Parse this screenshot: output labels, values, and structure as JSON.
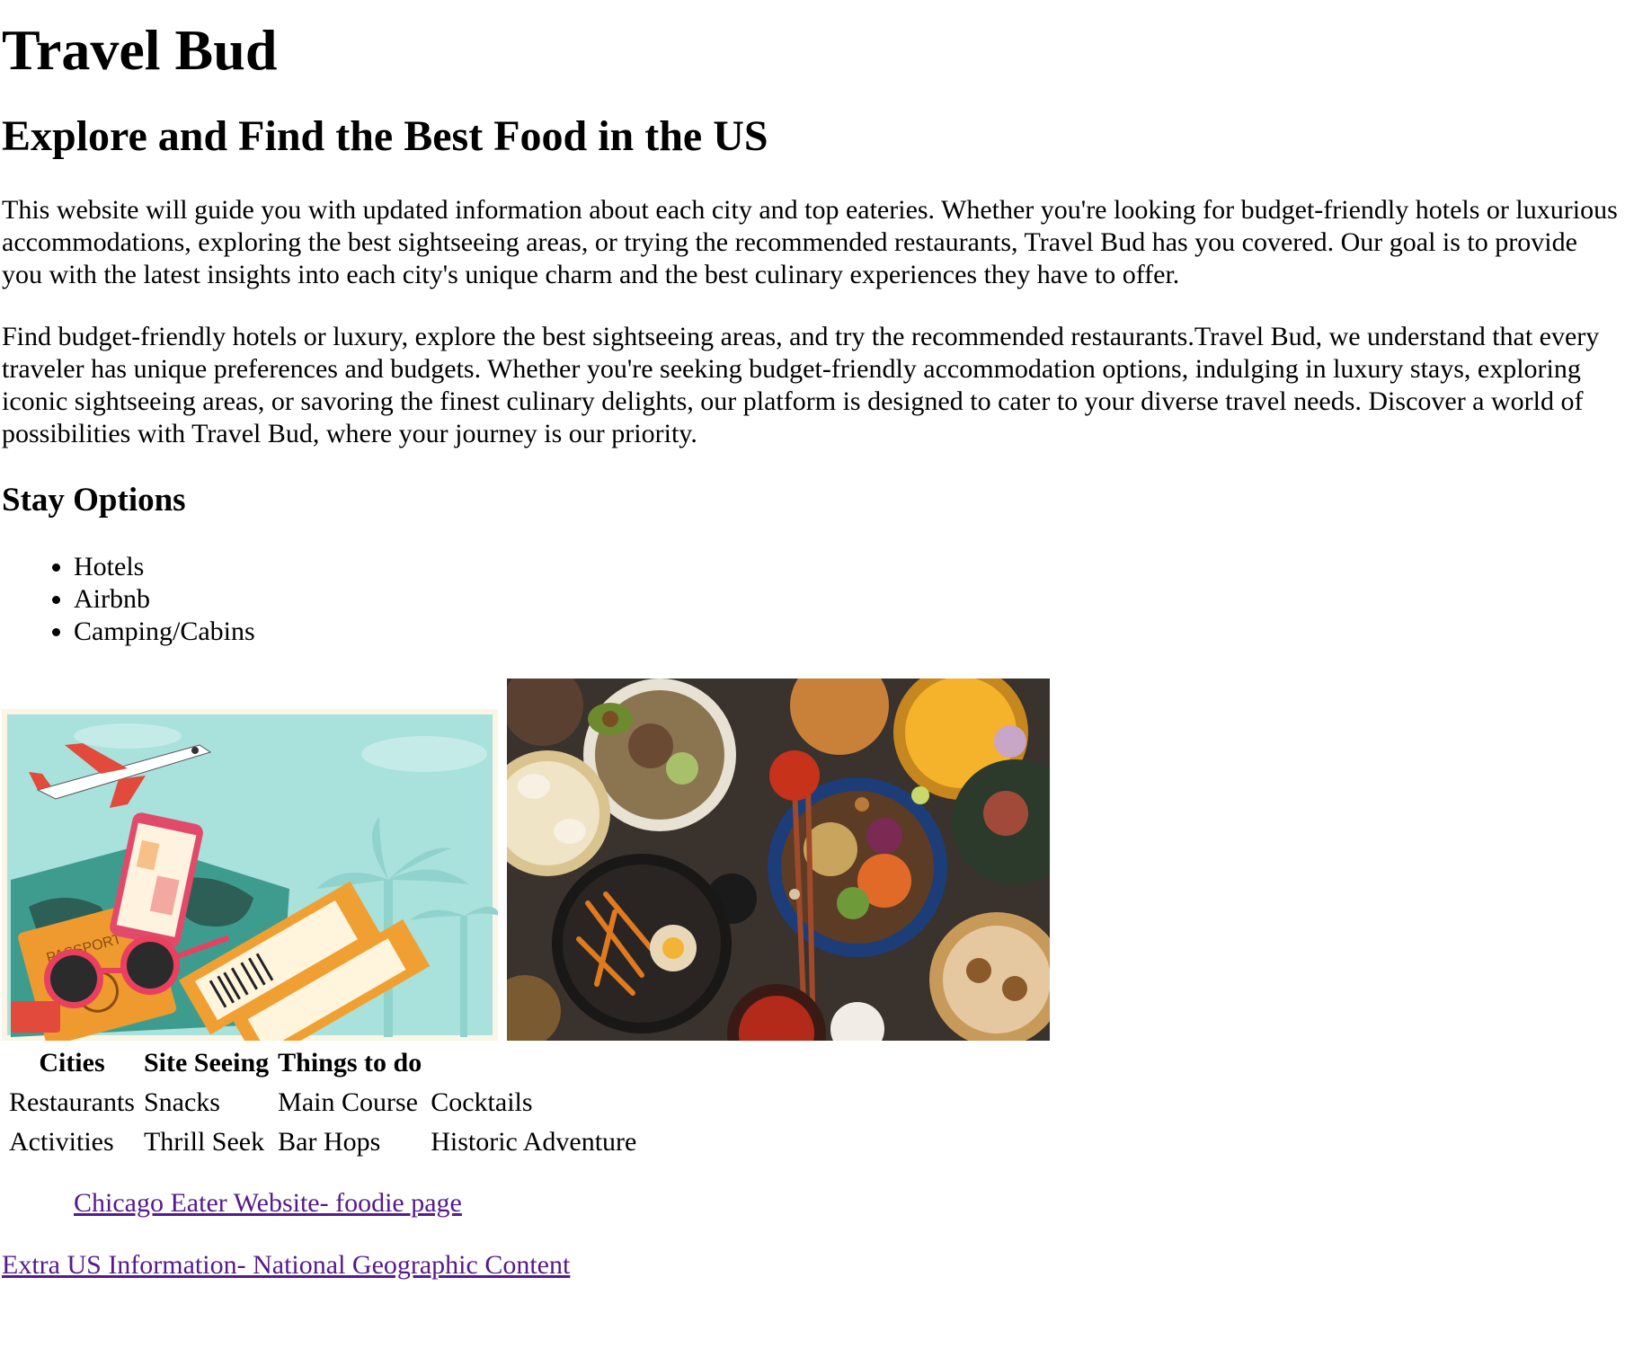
{
  "header": {
    "title": "Travel Bud",
    "subtitle": "Explore and Find the Best Food in the US"
  },
  "intro": {
    "paragraph1": "This website will guide you with updated information about each city and top eateries. Whether you're looking for budget-friendly hotels or luxurious accommodations, exploring the best sightseeing areas, or trying the recommended restaurants, Travel Bud has you covered. Our goal is to provide you with the latest insights into each city's unique charm and the best culinary experiences they have to offer.",
    "paragraph2": "Find budget-friendly hotels or luxury, explore the best sightseeing areas, and try the recommended restaurants.Travel Bud, we understand that every traveler has unique preferences and budgets. Whether you're seeking budget-friendly accommodation options, indulging in luxury stays, exploring iconic sightseeing areas, or savoring the finest culinary delights, our platform is designed to cater to your diverse travel needs. Discover a world of possibilities with Travel Bud, where your journey is our priority."
  },
  "stay": {
    "heading": "Stay Options",
    "items": [
      "Hotels",
      "Airbnb",
      "Camping/Cabins"
    ]
  },
  "images": {
    "travel_icon": "travel-illustration",
    "food_icon": "food-spread-photo",
    "passport_text": "PASSPORT"
  },
  "table": {
    "headers": [
      "Cities",
      "Site Seeing",
      "Things to do",
      ""
    ],
    "rows": [
      [
        "Restaurants",
        "Snacks",
        "Main Course",
        "Cocktails"
      ],
      [
        "Activities",
        "Thrill Seek",
        "Bar Hops",
        "Historic Adventure"
      ]
    ]
  },
  "links": {
    "link1": "Chicago Eater Website- foodie page",
    "link2": "Extra US Information- National Geographic Content"
  },
  "colors": {
    "link": "#551a8b",
    "travel_bg": "#a8e0dc",
    "map": "#3d9b8e",
    "ticket": "#f0a033"
  }
}
